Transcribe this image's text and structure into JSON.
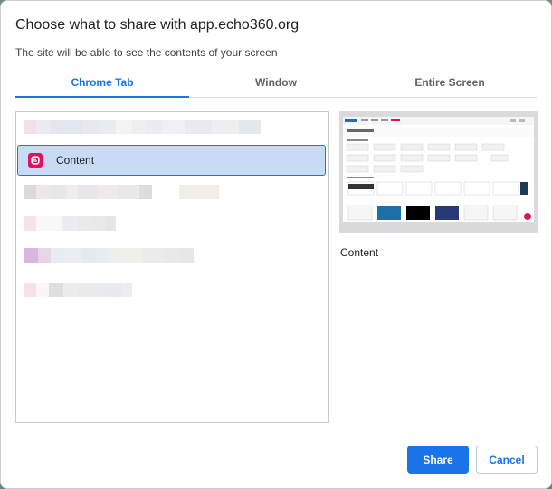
{
  "dialog": {
    "title": "Choose what to share with app.echo360.org",
    "subtitle": "The site will be able to see the contents of your screen"
  },
  "tabs": [
    {
      "label": "Chrome Tab",
      "active": true
    },
    {
      "label": "Window",
      "active": false
    },
    {
      "label": "Entire Screen",
      "active": false
    }
  ],
  "tab_list": {
    "selected_item": {
      "label": "Content",
      "icon": "blogger-icon"
    }
  },
  "preview": {
    "label": "Content"
  },
  "buttons": {
    "share": "Share",
    "cancel": "Cancel"
  },
  "colors": {
    "accent": "#1a73e8",
    "selected_bg": "#c8dbf4",
    "favicon": "#e0115f"
  }
}
